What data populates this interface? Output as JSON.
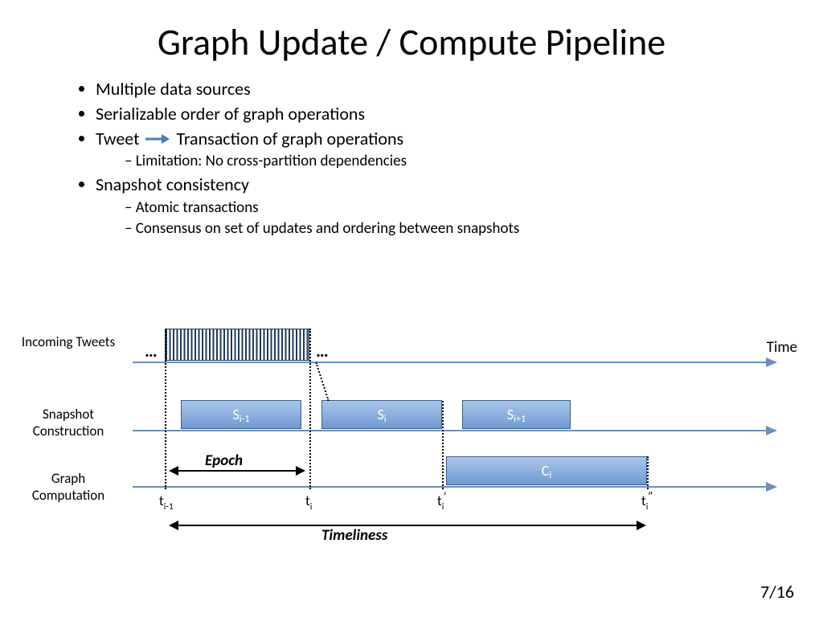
{
  "title": "Graph Update / Compute Pipeline",
  "bullets": {
    "b1": "Multiple data sources",
    "b2": "Serializable order of graph operations",
    "b3a": "Tweet",
    "b3b": "Transaction of graph operations",
    "b3s1": "Limitation: No cross-partition dependencies",
    "b4": "Snapshot consistency",
    "b4s1": "Atomic transactions",
    "b4s2": "Consensus on set of updates and ordering between snapshots"
  },
  "labels": {
    "incoming": "Incoming Tweets",
    "snapshot": "Snapshot Construction",
    "graph": "Graph Computation",
    "time": "Time",
    "epoch": "Epoch",
    "timeliness": "Timeliness",
    "dots": "…"
  },
  "boxes": {
    "sPrev": "S",
    "sPrevSub": "i-1",
    "sCur": "S",
    "sCurSub": "i",
    "sNext": "S",
    "sNextSub": "i+1",
    "cCur": "C",
    "cCurSub": "i"
  },
  "ticks": {
    "tPrev": "t",
    "tPrevSub": "i-1",
    "tCur": "t",
    "tCurSub": "i",
    "tPrime": "t",
    "tPrimeSub": "i",
    "tPrimeSup": "′",
    "tDbl": "t",
    "tDblSub": "i",
    "tDblSup": "″"
  },
  "page": "7/16"
}
